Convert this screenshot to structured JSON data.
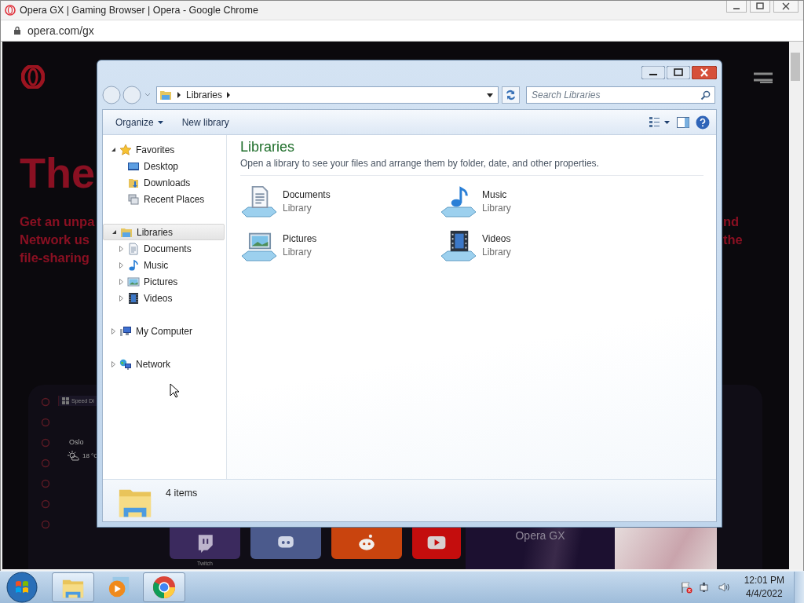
{
  "browser": {
    "title": "Opera GX | Gaming Browser | Opera - Google Chrome",
    "url": "opera.com/gx"
  },
  "page": {
    "headline": "The",
    "text_left": [
      "Get an unpa",
      "Network us",
      "file-sharing"
    ],
    "text_right": [
      "nd",
      "the"
    ],
    "mockup": {
      "tab": "Speed Di",
      "city": "Oslo",
      "temperature": "18 °C",
      "banner": "Opera GX",
      "tiles": [
        {
          "kind": "twitch",
          "label": "Twitch",
          "color": "#3b2a5e"
        },
        {
          "kind": "discord",
          "color": "#4b5a8c"
        },
        {
          "kind": "reddit",
          "color": "#c9440e"
        },
        {
          "kind": "youtube",
          "color": "#c40d0d"
        }
      ]
    }
  },
  "explorer": {
    "breadcrumb": [
      "Libraries"
    ],
    "search": {
      "placeholder": "Search Libraries"
    },
    "toolbar": [
      {
        "label": "Organize",
        "dropdown": true
      },
      {
        "label": "New library",
        "dropdown": false
      }
    ],
    "nav": [
      {
        "label": "Favorites",
        "kind": "star",
        "expanded": true,
        "selected": false,
        "children": [
          {
            "label": "Desktop",
            "kind": "desktop",
            "selected": false
          },
          {
            "label": "Downloads",
            "kind": "downloads",
            "selected": false
          },
          {
            "label": "Recent Places",
            "kind": "recent",
            "selected": false
          }
        ]
      },
      {
        "label": "Libraries",
        "kind": "library",
        "expanded": true,
        "selected": true,
        "children": [
          {
            "label": "Documents",
            "kind": "documents",
            "expanded": false,
            "selected": false
          },
          {
            "label": "Music",
            "kind": "music",
            "expanded": false,
            "selected": false
          },
          {
            "label": "Pictures",
            "kind": "pictures",
            "expanded": false,
            "selected": false
          },
          {
            "label": "Videos",
            "kind": "videos",
            "expanded": false,
            "selected": false
          }
        ]
      },
      {
        "label": "My Computer",
        "kind": "computer",
        "expanded": false,
        "selected": false
      },
      {
        "label": "Network",
        "kind": "network",
        "expanded": false,
        "selected": false
      }
    ],
    "heading": "Libraries",
    "description": "Open a library to see your files and arrange them by folder, date, and other properties.",
    "items": [
      {
        "name": "Documents",
        "type": "Library",
        "kind": "documents"
      },
      {
        "name": "Music",
        "type": "Library",
        "kind": "music"
      },
      {
        "name": "Pictures",
        "type": "Library",
        "kind": "pictures"
      },
      {
        "name": "Videos",
        "type": "Library",
        "kind": "videos"
      }
    ],
    "status": "4 items"
  },
  "taskbar": {
    "apps": [
      {
        "kind": "explorer",
        "selected": true
      },
      {
        "kind": "media",
        "selected": false
      },
      {
        "kind": "chrome",
        "selected": true
      }
    ],
    "tray": [
      {
        "kind": "flag"
      },
      {
        "kind": "network"
      },
      {
        "kind": "volume"
      }
    ],
    "time": "12:01 PM",
    "date": "4/4/2022"
  }
}
